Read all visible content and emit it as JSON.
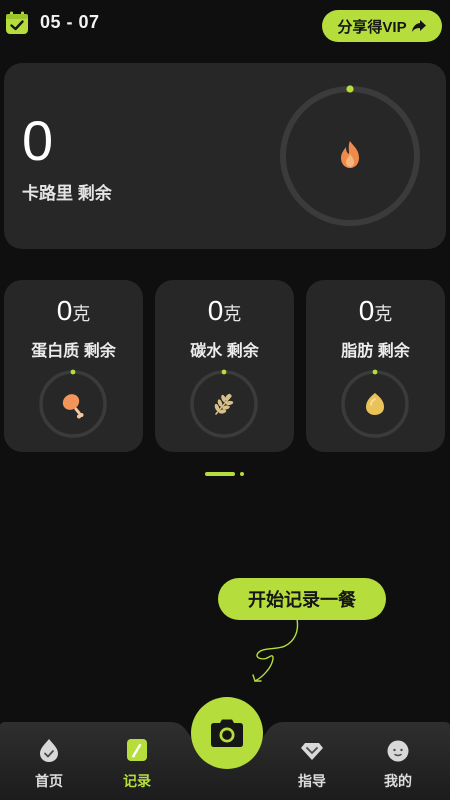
{
  "header": {
    "date": "05 - 07",
    "share_vip_label": "分享得VIP",
    "icons": [
      "calendar-check-icon",
      "share-arrow-icon"
    ]
  },
  "calories": {
    "value": "0",
    "label": "卡路里 剩余",
    "remaining_fraction": 0,
    "icon": "flame-icon"
  },
  "macros": [
    {
      "value": "0",
      "unit": "克",
      "label": "蛋白质 剩余",
      "icon": "drumstick-icon",
      "remaining_fraction": 0
    },
    {
      "value": "0",
      "unit": "克",
      "label": "碳水 剩余",
      "icon": "wheat-icon",
      "remaining_fraction": 0
    },
    {
      "value": "0",
      "unit": "克",
      "label": "脂肪 剩余",
      "icon": "oil-drop-icon",
      "remaining_fraction": 0
    }
  ],
  "pager": {
    "pages": 2,
    "active": 0
  },
  "start_prompt": "开始记录一餐",
  "tabs": [
    {
      "label": "首页",
      "icon": "home-droplet-icon",
      "active": false
    },
    {
      "label": "记录",
      "icon": "record-pen-icon",
      "active": true
    },
    {
      "label": "指导",
      "icon": "guide-diamond-icon",
      "active": false
    },
    {
      "label": "我的",
      "icon": "profile-face-icon",
      "active": false
    }
  ],
  "colors": {
    "accent": "#b5de3c",
    "background": "#0f0f0f",
    "card": "#262726",
    "ring_track": "#3a3b3a",
    "flame": "#f08a4b",
    "drumstick": "#f2955a",
    "wheat": "#d9c08a",
    "oil": "#e9c25a"
  }
}
